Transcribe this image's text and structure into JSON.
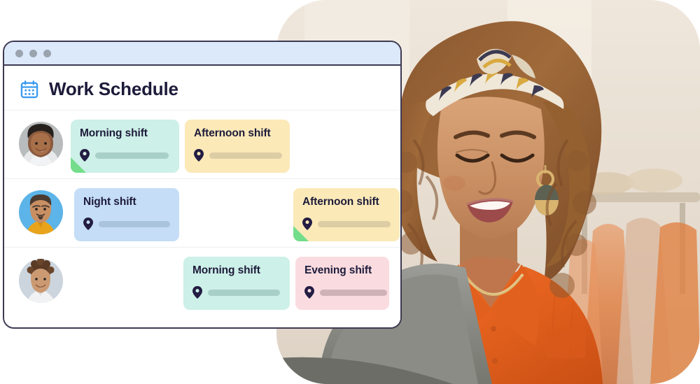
{
  "window": {
    "titlebar": {
      "dots": [
        "dot-1",
        "dot-2",
        "dot-3"
      ],
      "dot_color": "#9aa3ae",
      "background": "#dce9fb"
    },
    "border_color": "#3d3a52"
  },
  "header": {
    "icon": "calendar-icon",
    "icon_color": "#3b9bf0",
    "title": "Work Schedule"
  },
  "accent": {
    "green_flag": "#73dd8b",
    "text": "#1d1b3a"
  },
  "schedule": {
    "rows": [
      {
        "avatar": "avatar-employee-1",
        "shifts": [
          {
            "label": "Morning shift",
            "color_key": "c-teal",
            "pin": "location-pin-icon",
            "bar": "location-placeholder-bar",
            "flag": true
          },
          {
            "label": "Afternoon shift",
            "color_key": "c-yellow",
            "pin": "location-pin-icon",
            "bar": "location-placeholder-bar",
            "flag": false
          }
        ]
      },
      {
        "avatar": "avatar-employee-2",
        "shifts": [
          {
            "label": "Night shift",
            "color_key": "c-blue",
            "pin": "location-pin-icon",
            "bar": "location-placeholder-bar",
            "flag": false
          },
          {
            "label": "Afternoon shift",
            "color_key": "c-yellow",
            "pin": "location-pin-icon",
            "bar": "location-placeholder-bar",
            "flag": true
          }
        ]
      },
      {
        "avatar": "avatar-employee-3",
        "shifts": [
          {
            "label": "Morning shift",
            "color_key": "c-teal",
            "pin": "location-pin-icon",
            "bar": "location-placeholder-bar",
            "flag": false
          },
          {
            "label": "Evening shift",
            "color_key": "c-pink",
            "pin": "location-pin-icon",
            "bar": "location-placeholder-bar",
            "flag": false
          }
        ]
      }
    ]
  },
  "photo": {
    "name": "hero-photo-woman-with-laptop",
    "description": "Smiling woman with curly hair and striped headband wearing an orange blouse, working on a laptop in a boutique"
  }
}
